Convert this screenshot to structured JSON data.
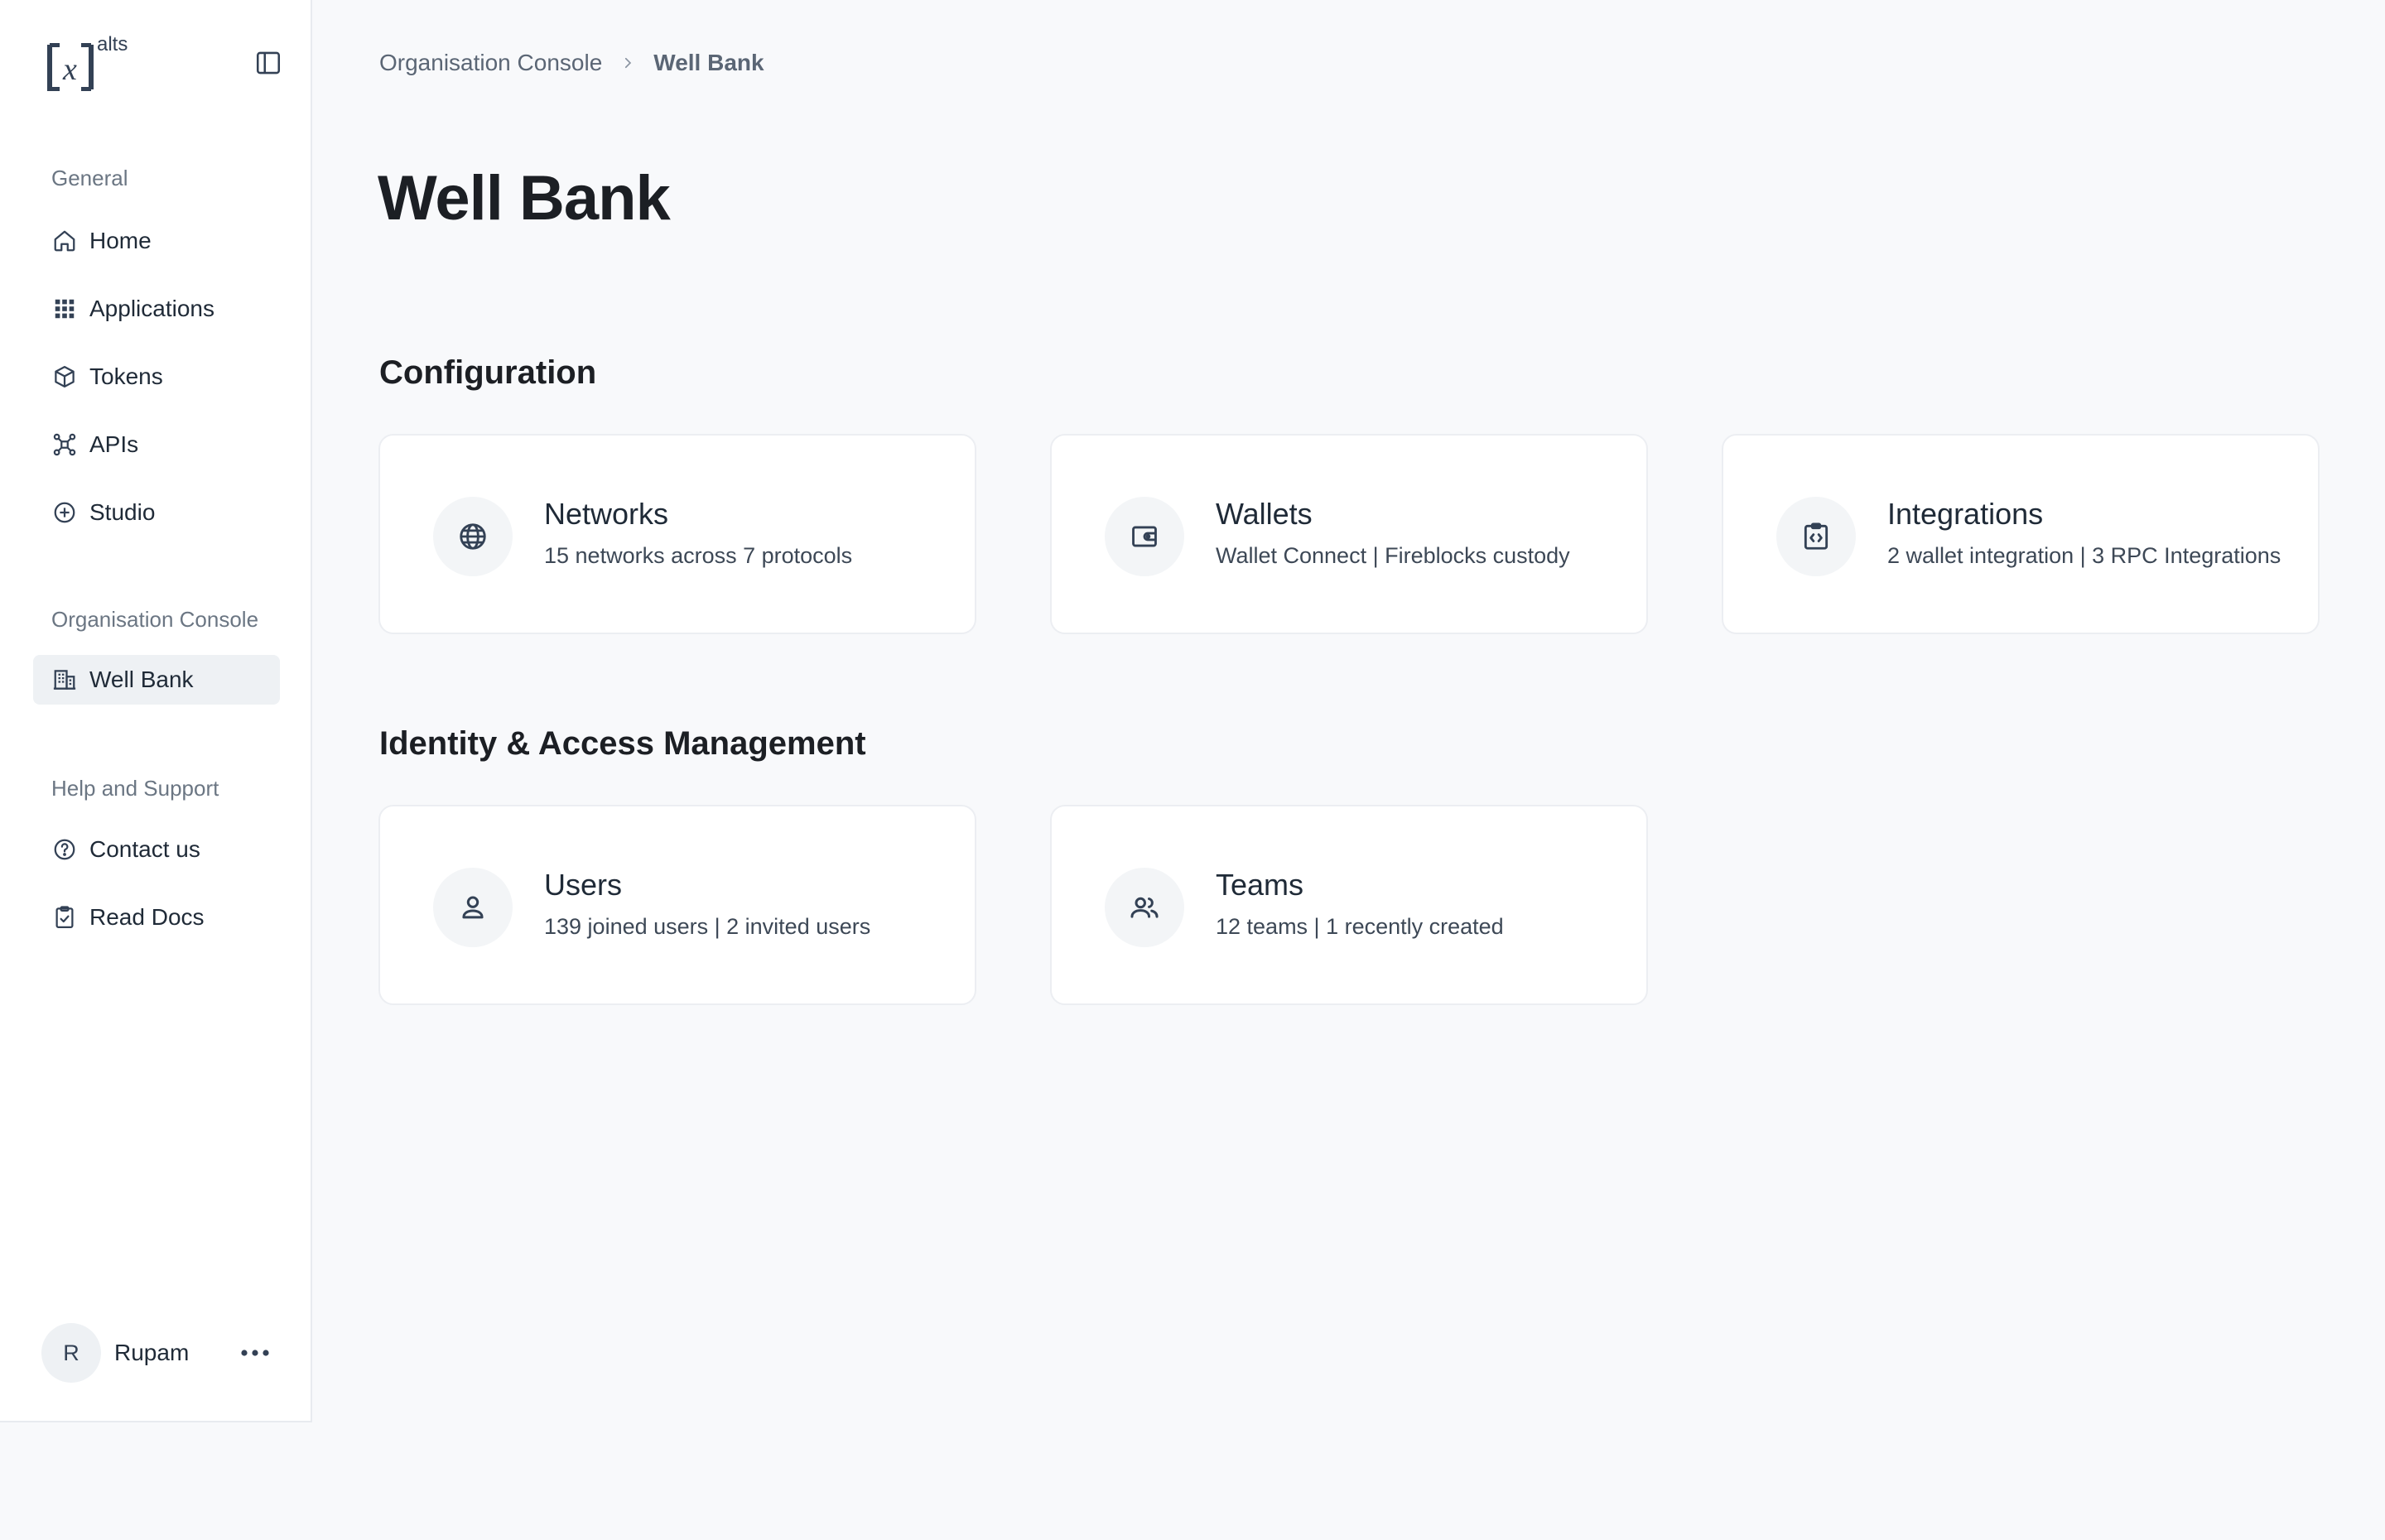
{
  "sidebar": {
    "logo_symbol": "x",
    "logo_sup": "alts",
    "sections": [
      {
        "label": "General",
        "items": [
          {
            "label": "Home",
            "icon": "home-icon"
          },
          {
            "label": "Applications",
            "icon": "grid-icon"
          },
          {
            "label": "Tokens",
            "icon": "cube-icon"
          },
          {
            "label": "APIs",
            "icon": "network-icon"
          },
          {
            "label": "Studio",
            "icon": "plus-circle-icon"
          }
        ]
      },
      {
        "label": "Organisation Console",
        "items": [
          {
            "label": "Well Bank",
            "icon": "building-icon",
            "active": true
          }
        ]
      },
      {
        "label": "Help and Support",
        "items": [
          {
            "label": "Contact us",
            "icon": "help-circle-icon"
          },
          {
            "label": "Read Docs",
            "icon": "clipboard-check-icon"
          }
        ]
      }
    ],
    "user": {
      "initial": "R",
      "name": "Rupam"
    }
  },
  "breadcrumb": {
    "parent": "Organisation Console",
    "current": "Well Bank"
  },
  "page_title": "Well Bank",
  "sections": {
    "configuration": {
      "title": "Configuration",
      "cards": [
        {
          "title": "Networks",
          "subtitle": "15 networks across 7 protocols",
          "icon": "globe-icon"
        },
        {
          "title": "Wallets",
          "subtitle": "Wallet Connect | Fireblocks custody",
          "icon": "wallet-icon"
        },
        {
          "title": "Integrations",
          "subtitle": "2 wallet integration | 3 RPC Integrations",
          "icon": "code-file-icon"
        }
      ]
    },
    "iam": {
      "title": "Identity & Access Management",
      "cards": [
        {
          "title": "Users",
          "subtitle": "139 joined users | 2 invited users",
          "icon": "user-icon"
        },
        {
          "title": "Teams",
          "subtitle": "12 teams | 1 recently created",
          "icon": "users-icon"
        }
      ]
    }
  },
  "colors": {
    "background": "#f8f9fb",
    "surface": "#ffffff",
    "text_primary": "#1c1f24",
    "text_muted": "#6b7683",
    "active_nav_bg": "#eef1f4",
    "brand": "#334155"
  }
}
